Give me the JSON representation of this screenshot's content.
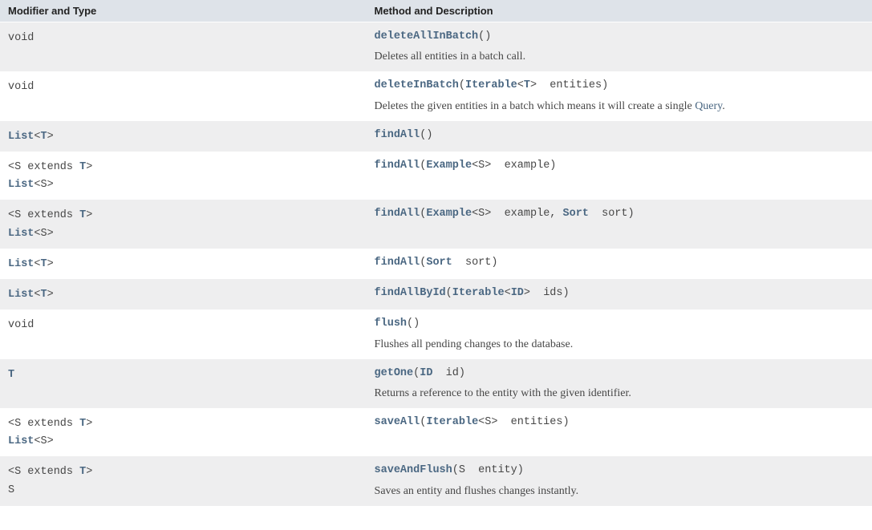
{
  "headers": {
    "modifier": "Modifier and Type",
    "method": "Method and Description"
  },
  "rows": [
    {
      "alt": true,
      "modifier": [
        {
          "t": "code",
          "v": "void"
        }
      ],
      "signature": [
        {
          "t": "mlink",
          "v": "deleteAllInBatch"
        },
        {
          "t": "code",
          "v": "()"
        }
      ],
      "description": [
        {
          "t": "text",
          "v": "Deletes all entities in a batch call."
        }
      ]
    },
    {
      "alt": false,
      "modifier": [
        {
          "t": "code",
          "v": "void"
        }
      ],
      "signature": [
        {
          "t": "mlink",
          "v": "deleteInBatch"
        },
        {
          "t": "code",
          "v": "("
        },
        {
          "t": "tlink",
          "v": "Iterable"
        },
        {
          "t": "code",
          "v": "<"
        },
        {
          "t": "tlink",
          "v": "T"
        },
        {
          "t": "code",
          "v": ">  entities)"
        }
      ],
      "description": [
        {
          "t": "text",
          "v": "Deletes the given entities in a batch which means it will create a single "
        },
        {
          "t": "tlink",
          "v": "Query"
        },
        {
          "t": "text",
          "v": "."
        }
      ]
    },
    {
      "alt": true,
      "modifier": [
        {
          "t": "tlink",
          "v": "List"
        },
        {
          "t": "code",
          "v": "<"
        },
        {
          "t": "tlink",
          "v": "T"
        },
        {
          "t": "code",
          "v": ">"
        }
      ],
      "signature": [
        {
          "t": "mlink",
          "v": "findAll"
        },
        {
          "t": "code",
          "v": "()"
        }
      ]
    },
    {
      "alt": false,
      "modifier": [
        {
          "t": "code",
          "v": "<S extends "
        },
        {
          "t": "tlink",
          "v": "T"
        },
        {
          "t": "code",
          "v": ">\n"
        },
        {
          "t": "tlink",
          "v": "List"
        },
        {
          "t": "code",
          "v": "<S>"
        }
      ],
      "signature": [
        {
          "t": "mlink",
          "v": "findAll"
        },
        {
          "t": "code",
          "v": "("
        },
        {
          "t": "tlink",
          "v": "Example"
        },
        {
          "t": "code",
          "v": "<S>  example)"
        }
      ]
    },
    {
      "alt": true,
      "modifier": [
        {
          "t": "code",
          "v": "<S extends "
        },
        {
          "t": "tlink",
          "v": "T"
        },
        {
          "t": "code",
          "v": ">\n"
        },
        {
          "t": "tlink",
          "v": "List"
        },
        {
          "t": "code",
          "v": "<S>"
        }
      ],
      "signature": [
        {
          "t": "mlink",
          "v": "findAll"
        },
        {
          "t": "code",
          "v": "("
        },
        {
          "t": "tlink",
          "v": "Example"
        },
        {
          "t": "code",
          "v": "<S>  example, "
        },
        {
          "t": "tlink",
          "v": "Sort"
        },
        {
          "t": "code",
          "v": "  sort)"
        }
      ]
    },
    {
      "alt": false,
      "modifier": [
        {
          "t": "tlink",
          "v": "List"
        },
        {
          "t": "code",
          "v": "<"
        },
        {
          "t": "tlink",
          "v": "T"
        },
        {
          "t": "code",
          "v": ">"
        }
      ],
      "signature": [
        {
          "t": "mlink",
          "v": "findAll"
        },
        {
          "t": "code",
          "v": "("
        },
        {
          "t": "tlink",
          "v": "Sort"
        },
        {
          "t": "code",
          "v": "  sort)"
        }
      ]
    },
    {
      "alt": true,
      "modifier": [
        {
          "t": "tlink",
          "v": "List"
        },
        {
          "t": "code",
          "v": "<"
        },
        {
          "t": "tlink",
          "v": "T"
        },
        {
          "t": "code",
          "v": ">"
        }
      ],
      "signature": [
        {
          "t": "mlink",
          "v": "findAllById"
        },
        {
          "t": "code",
          "v": "("
        },
        {
          "t": "tlink",
          "v": "Iterable"
        },
        {
          "t": "code",
          "v": "<"
        },
        {
          "t": "tlink",
          "v": "ID"
        },
        {
          "t": "code",
          "v": ">  ids)"
        }
      ]
    },
    {
      "alt": false,
      "modifier": [
        {
          "t": "code",
          "v": "void"
        }
      ],
      "signature": [
        {
          "t": "mlink",
          "v": "flush"
        },
        {
          "t": "code",
          "v": "()"
        }
      ],
      "description": [
        {
          "t": "text",
          "v": "Flushes all pending changes to the database."
        }
      ]
    },
    {
      "alt": true,
      "modifier": [
        {
          "t": "tlink",
          "v": "T"
        }
      ],
      "signature": [
        {
          "t": "mlink",
          "v": "getOne"
        },
        {
          "t": "code",
          "v": "("
        },
        {
          "t": "tlink",
          "v": "ID"
        },
        {
          "t": "code",
          "v": "  id)"
        }
      ],
      "description": [
        {
          "t": "text",
          "v": "Returns a reference to the entity with the given identifier."
        }
      ]
    },
    {
      "alt": false,
      "modifier": [
        {
          "t": "code",
          "v": "<S extends "
        },
        {
          "t": "tlink",
          "v": "T"
        },
        {
          "t": "code",
          "v": ">\n"
        },
        {
          "t": "tlink",
          "v": "List"
        },
        {
          "t": "code",
          "v": "<S>"
        }
      ],
      "signature": [
        {
          "t": "mlink",
          "v": "saveAll"
        },
        {
          "t": "code",
          "v": "("
        },
        {
          "t": "tlink",
          "v": "Iterable"
        },
        {
          "t": "code",
          "v": "<S>  entities)"
        }
      ]
    },
    {
      "alt": true,
      "modifier": [
        {
          "t": "code",
          "v": "<S extends "
        },
        {
          "t": "tlink",
          "v": "T"
        },
        {
          "t": "code",
          "v": ">\nS"
        }
      ],
      "signature": [
        {
          "t": "mlink",
          "v": "saveAndFlush"
        },
        {
          "t": "code",
          "v": "(S  entity)"
        }
      ],
      "description": [
        {
          "t": "text",
          "v": "Saves an entity and flushes changes instantly."
        }
      ]
    }
  ]
}
